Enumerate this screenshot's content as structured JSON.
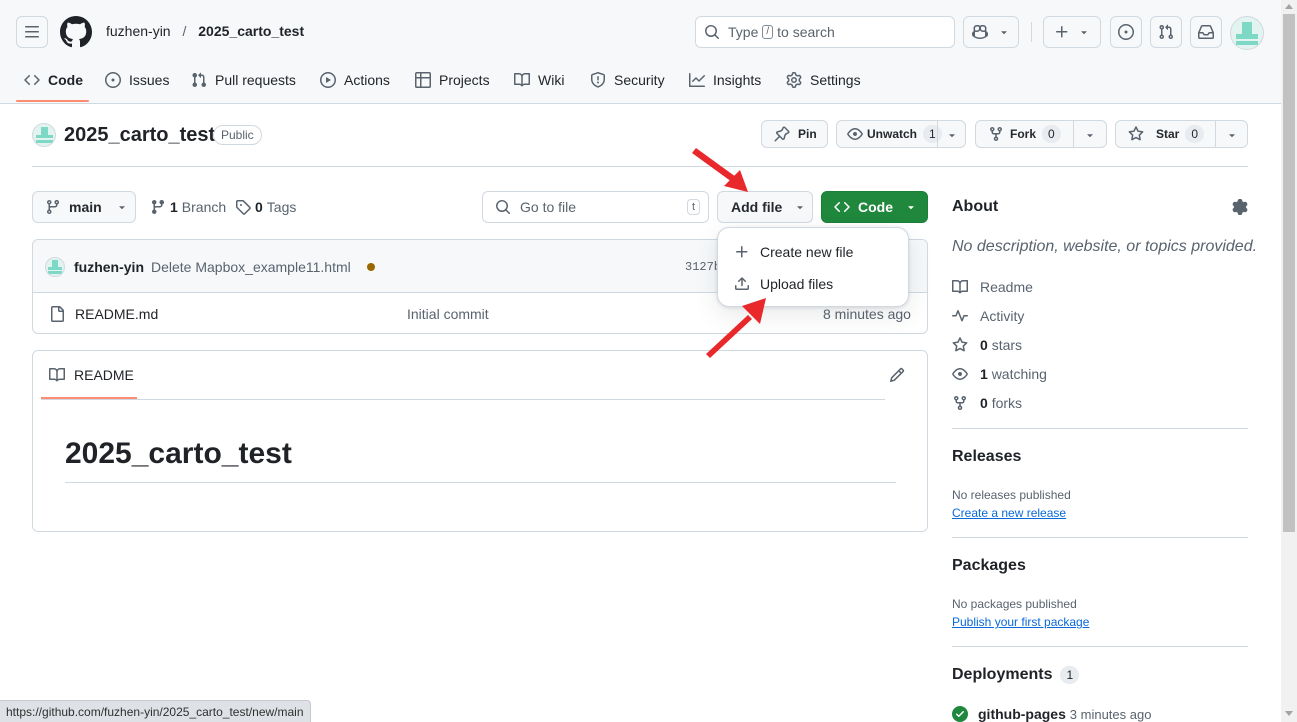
{
  "header": {
    "owner": "fuzhen-yin",
    "separator": "/",
    "repo": "2025_carto_test",
    "search_before": "Type",
    "search_key": "/",
    "search_after": "to search"
  },
  "nav_tabs": [
    {
      "label": "Code",
      "icon": "code-icon"
    },
    {
      "label": "Issues",
      "icon": "issue-icon"
    },
    {
      "label": "Pull requests",
      "icon": "pull-request-icon"
    },
    {
      "label": "Actions",
      "icon": "play-icon"
    },
    {
      "label": "Projects",
      "icon": "table-icon"
    },
    {
      "label": "Wiki",
      "icon": "book-icon"
    },
    {
      "label": "Security",
      "icon": "shield-icon"
    },
    {
      "label": "Insights",
      "icon": "graph-icon"
    },
    {
      "label": "Settings",
      "icon": "gear-icon"
    }
  ],
  "repo_header": {
    "name": "2025_carto_test",
    "visibility": "Public",
    "pin_label": "Pin",
    "watch_label": "Unwatch",
    "watch_count": "1",
    "fork_label": "Fork",
    "fork_count": "0",
    "star_label": "Star",
    "star_count": "0"
  },
  "toolbar": {
    "branch": "main",
    "branch_count": "1",
    "branch_label": "Branch",
    "tag_count": "0",
    "tag_label": "Tags",
    "goto_placeholder": "Go to file",
    "goto_key": "t",
    "add_file_label": "Add file",
    "code_label": "Code"
  },
  "add_file_menu": [
    {
      "label": "Create new file",
      "icon": "plus-icon"
    },
    {
      "label": "Upload files",
      "icon": "upload-icon"
    }
  ],
  "commit": {
    "author": "fuzhen-yin",
    "message": "Delete Mapbox_example11.html",
    "status_color": "#9a6700",
    "sha_partial": "3127b"
  },
  "files": [
    {
      "name": "README.md",
      "message": "Initial commit",
      "time": "8 minutes ago"
    }
  ],
  "readme": {
    "tab_label": "README",
    "heading": "2025_carto_test"
  },
  "about": {
    "title": "About",
    "description": "No description, website, or topics provided.",
    "readme": "Readme",
    "activity": "Activity",
    "stars_count": "0",
    "stars_label": "stars",
    "watching_count": "1",
    "watching_label": "watching",
    "forks_count": "0",
    "forks_label": "forks"
  },
  "releases": {
    "title": "Releases",
    "none": "No releases published",
    "link": "Create a new release"
  },
  "packages": {
    "title": "Packages",
    "none": "No packages published",
    "link": "Publish your first package"
  },
  "deployments": {
    "title": "Deployments",
    "count": "1",
    "item": "github-pages",
    "time": "3 minutes ago"
  },
  "status_bar": {
    "url": "https://github.com/fuzhen-yin/2025_carto_test/new/main"
  },
  "colors": {
    "accent_green": "#1f883d",
    "tab_underline": "#fd8c73",
    "link": "#0969da",
    "annotation_arrow": "#e8282b"
  }
}
